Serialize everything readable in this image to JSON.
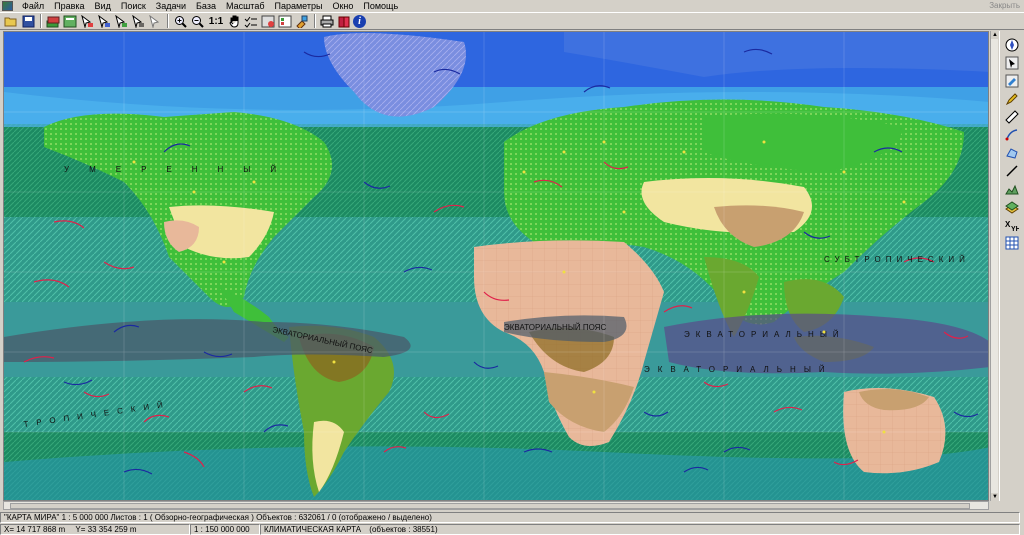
{
  "menubar": {
    "items": [
      "Файл",
      "Правка",
      "Вид",
      "Поиск",
      "Задачи",
      "База",
      "Масштаб",
      "Параметры",
      "Окно",
      "Помощь"
    ],
    "close_label": "Закрыть"
  },
  "toolbar": {
    "scale_label": "1:1"
  },
  "map": {
    "labels": {
      "equator_belt_americas": "ЭКВАТОРИАЛЬНЫЙ ПОЯС",
      "equator_belt_africa": "ЭКВАТОРИАЛЬНЫЙ ПОЯС",
      "equatorial_east": "ЭКВАТОРИАЛЬНЫЙ",
      "equatorial_east2": "ЭКВАТОРИАЛЬНЫЙ",
      "tropical_west": "ТРОПИЧЕСКИЙ",
      "subtropical_east": "СУБТРОПИЧЕСКИЙ",
      "moderate_letters": "УМЕРЕННЫЙ"
    }
  },
  "status": {
    "map_name": "\"КАРТА МИРА\"  1 : 5 000 000  Листов : 1  ( Обзорно-географическая )  Объектов : 632061 / 0 (отображено / выделено)",
    "coord_x_label": "X=",
    "coord_x": "14 717 868 m",
    "coord_y_label": "Y=",
    "coord_y": "33 354 259 m",
    "scale": "1 : 150 000 000",
    "layer": "КЛИМАТИЧЕСКАЯ КАРТА",
    "layer_objects": "(объектов : 38551)"
  },
  "colors": {
    "ocean_equatorial": "#2f9a8a",
    "ocean_temperate": "#1e8f6a",
    "ocean_arctic": "#3fa0e6",
    "ocean_polar": "#6a8ed8",
    "land_forest": "#3fbf3a",
    "land_desert": "#e8b89a",
    "equatorial_belt": "#5a6a7a",
    "warm_current": "#e0204a",
    "cold_current": "#1a2aa0"
  }
}
